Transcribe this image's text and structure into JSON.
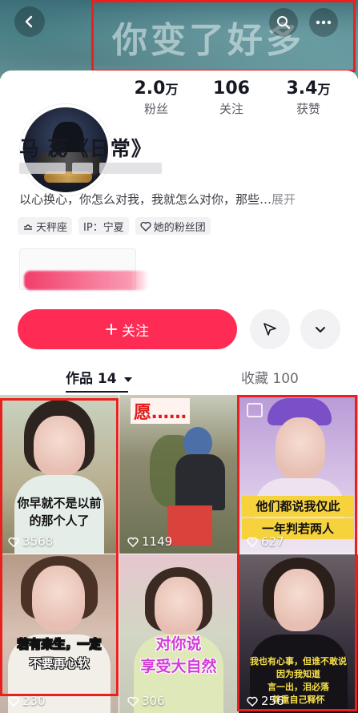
{
  "header": {
    "banner_text": "你变了好多",
    "back_icon": "chevron-left-icon",
    "search_icon": "search-icon",
    "more_icon": "more-dots-icon"
  },
  "profile": {
    "stats": [
      {
        "value": "2.0",
        "unit": "万",
        "label": "粉丝"
      },
      {
        "value": "106",
        "unit": "",
        "label": "关注"
      },
      {
        "value": "3.4",
        "unit": "万",
        "label": "获赞"
      }
    ],
    "name": "马 蕊《日常》",
    "bio": "以心换心，你怎么对我，我就怎么对你，那些…",
    "bio_more": "展开",
    "tags": [
      {
        "icon": "libra-icon",
        "label": "天秤座"
      },
      {
        "icon": "",
        "label": "IP：宁夏"
      },
      {
        "icon": "heart-outline-icon",
        "label": "她的粉丝团"
      }
    ]
  },
  "actions": {
    "follow_label": "关注",
    "share_icon": "send-icon",
    "expand_icon": "chevron-down-icon"
  },
  "tabs": {
    "works": "作品 14",
    "favorites": "收藏 100"
  },
  "videos": [
    {
      "caption": "你早就不是以前的那个人了",
      "caption_line1": "你早就不是以前",
      "caption_line2": "的那个人了",
      "likes": "3568"
    },
    {
      "caption": "愿……",
      "likes": "1149"
    },
    {
      "caption_line1": "他们都说我仅此",
      "caption_line2": "一年判若两人",
      "likes": "627"
    },
    {
      "caption_line1": "若有来生，一定",
      "caption_line2": "不要再心软",
      "likes": "230"
    },
    {
      "caption_line1": "对你说",
      "caption_line2": "享受大自然",
      "likes": "306"
    },
    {
      "caption_line1": "我也有心事，但谁不敢说",
      "caption_line2": "因为我知道",
      "caption_line3": "言一出，泪必落",
      "caption_line4": "尊重自己释怀",
      "likes": "256"
    }
  ],
  "colors": {
    "accent": "#fe2c55",
    "highlight_box": "#e8211e"
  }
}
